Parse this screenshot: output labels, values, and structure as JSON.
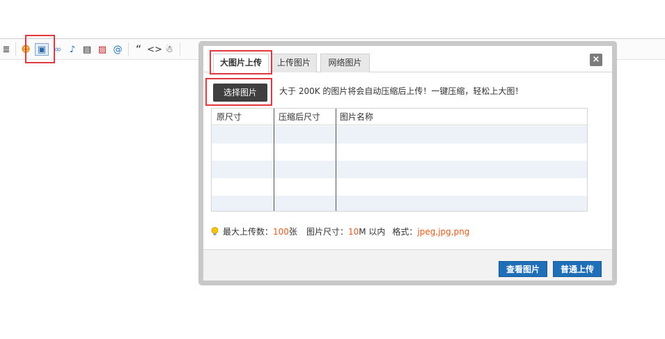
{
  "toolbar": {
    "icons": [
      "list-icon",
      "emoticon-icon",
      "image-icon",
      "link-icon",
      "music-icon",
      "video-icon",
      "flash-icon",
      "at-icon",
      "quote-icon",
      "code-icon",
      "qq-icon"
    ],
    "glyphs": {
      "list": "≣",
      "emoticon": "☻",
      "image": "▣",
      "link": "∞",
      "music": "♪",
      "video": "▤",
      "flash": "▨",
      "at": "@",
      "quote": "“",
      "code": "<>",
      "qq": "☃"
    }
  },
  "dialog": {
    "tabs": [
      {
        "label": "大图片上传",
        "active": true
      },
      {
        "label": "上传图片",
        "active": false
      },
      {
        "label": "网络图片",
        "active": false
      }
    ],
    "close_glyph": "×",
    "choose_button": "选择图片",
    "hint": "大于 200K 的图片将会自动压缩后上传！一键压缩，轻松上大图！",
    "table": {
      "headers": [
        "原尺寸",
        "压缩后尺寸",
        "图片名称"
      ],
      "rows": 5
    },
    "limits": {
      "max_label": "最大上传数：",
      "max_value": "100",
      "max_unit": " 张",
      "size_label": "图片尺寸：",
      "size_value": "10",
      "size_unit": " M 以内",
      "format_label": "格式：",
      "format_value": "jpeg,jpg,png"
    },
    "footer": {
      "view_button": "查看图片",
      "normal_upload_button": "普通上传"
    }
  },
  "colors": {
    "highlight": "#e0383e",
    "primary_button": "#1f6fb8",
    "accent_text": "#e05a1b"
  }
}
